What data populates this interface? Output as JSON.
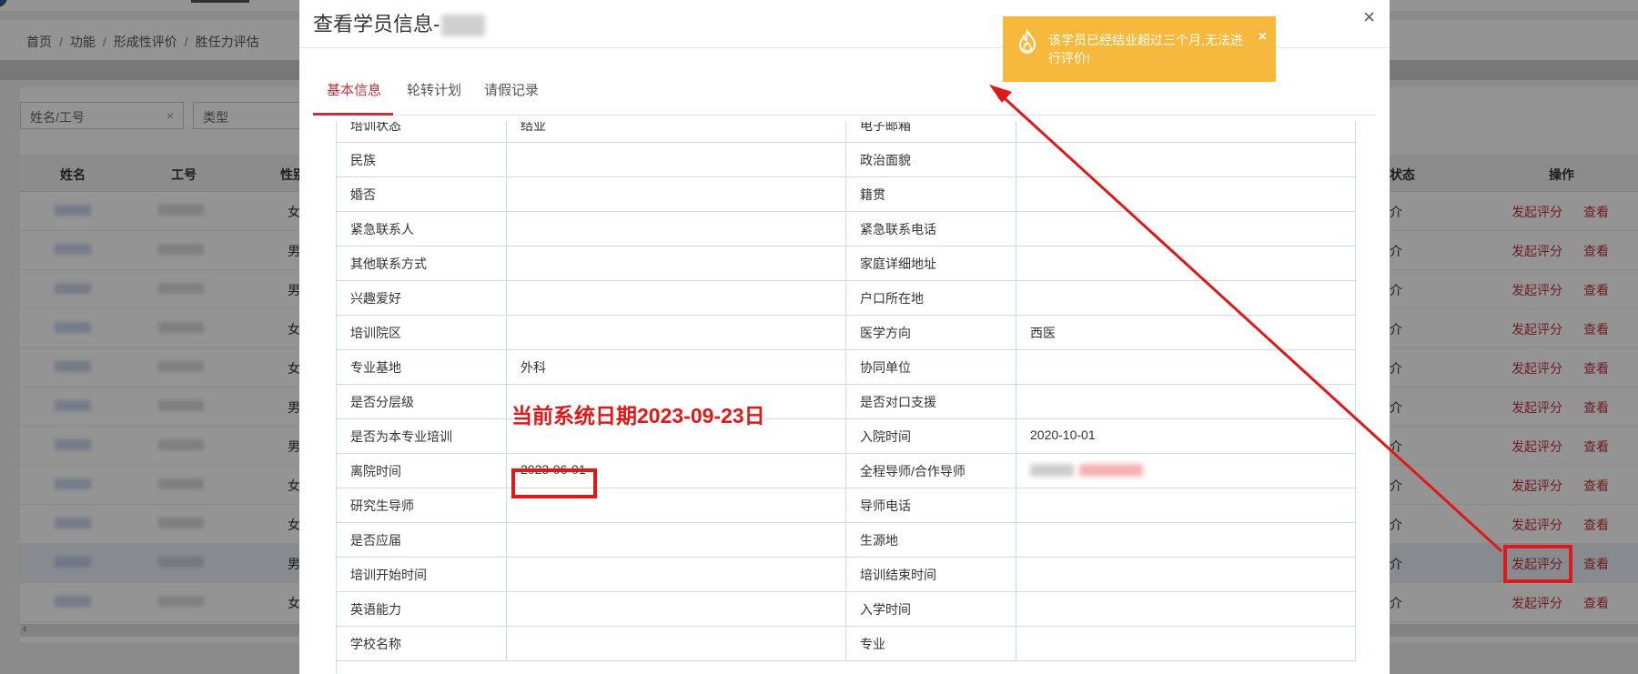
{
  "breadcrumb": [
    "首页",
    "功能",
    "形成性评价",
    "胜任力评估"
  ],
  "filters": {
    "name_placeholder": "姓名/工号",
    "name_clear": "×",
    "type_placeholder": "类型"
  },
  "list": {
    "headers": {
      "name": "姓名",
      "id": "工号",
      "gender": "性别",
      "status": "状态",
      "ops": "操作"
    },
    "rows": [
      {
        "gender": "女",
        "status": "介",
        "action_evaluate": "发起评分",
        "action_view": "查看"
      },
      {
        "gender": "男",
        "status": "介",
        "action_evaluate": "发起评分",
        "action_view": "查看"
      },
      {
        "gender": "男",
        "status": "介",
        "action_evaluate": "发起评分",
        "action_view": "查看"
      },
      {
        "gender": "女",
        "status": "介",
        "action_evaluate": "发起评分",
        "action_view": "查看"
      },
      {
        "gender": "女",
        "status": "介",
        "action_evaluate": "发起评分",
        "action_view": "查看"
      },
      {
        "gender": "男",
        "status": "介",
        "action_evaluate": "发起评分",
        "action_view": "查看"
      },
      {
        "gender": "男",
        "status": "介",
        "action_evaluate": "发起评分",
        "action_view": "查看"
      },
      {
        "gender": "女",
        "status": "介",
        "action_evaluate": "发起评分",
        "action_view": "查看"
      },
      {
        "gender": "女",
        "status": "介",
        "action_evaluate": "发起评分",
        "action_view": "查看"
      },
      {
        "gender": "男",
        "status": "介",
        "action_evaluate": "发起评分",
        "action_view": "查看"
      },
      {
        "gender": "女",
        "status": "介",
        "action_evaluate": "发起评分",
        "action_view": "查看"
      }
    ]
  },
  "modal": {
    "title": "查看学员信息-",
    "close": "×",
    "tabs": [
      {
        "label": "基本信息",
        "active": true
      },
      {
        "label": "轮转计划",
        "active": false
      },
      {
        "label": "请假记录",
        "active": false
      }
    ],
    "rows": [
      {
        "l1": "培训状态",
        "v1": "结业",
        "l2": "电子邮箱",
        "v2": ""
      },
      {
        "l1": "民族",
        "v1": "",
        "l2": "政治面貌",
        "v2": ""
      },
      {
        "l1": "婚否",
        "v1": "",
        "l2": "籍贯",
        "v2": ""
      },
      {
        "l1": "紧急联系人",
        "v1": "",
        "l2": "紧急联系电话",
        "v2": ""
      },
      {
        "l1": "其他联系方式",
        "v1": "",
        "l2": "家庭详细地址",
        "v2": ""
      },
      {
        "l1": "兴趣爱好",
        "v1": "",
        "l2": "户口所在地",
        "v2": ""
      },
      {
        "l1": "培训院区",
        "v1": "",
        "l2": "医学方向",
        "v2": "西医"
      },
      {
        "l1": "专业基地",
        "v1": "外科",
        "l2": "协同单位",
        "v2": ""
      },
      {
        "l1": "是否分层级",
        "v1": "",
        "l2": "是否对口支援",
        "v2": ""
      },
      {
        "l1": "是否为本专业培训",
        "v1": "",
        "l2": "入院时间",
        "v2": "2020-10-01"
      },
      {
        "l1": "离院时间",
        "v1": "2023-06-01",
        "l2": "全程导师/合作导师",
        "v2": ""
      },
      {
        "l1": "研究生导师",
        "v1": "",
        "l2": "导师电话",
        "v2": ""
      },
      {
        "l1": "是否应届",
        "v1": "",
        "l2": "生源地",
        "v2": ""
      },
      {
        "l1": "培训开始时间",
        "v1": "",
        "l2": "培训结束时间",
        "v2": ""
      },
      {
        "l1": "英语能力",
        "v1": "",
        "l2": "入学时间",
        "v2": ""
      },
      {
        "l1": "学校名称",
        "v1": "",
        "l2": "专业",
        "v2": ""
      }
    ]
  },
  "toast": {
    "icon": "flame-icon",
    "message": "该学员已经结业超过三个月,无法进行评价!",
    "close": "×",
    "color": "#f6b93b"
  },
  "annotation": {
    "system_date": "当前系统日期2023-09-23日",
    "color": "#e01818"
  }
}
